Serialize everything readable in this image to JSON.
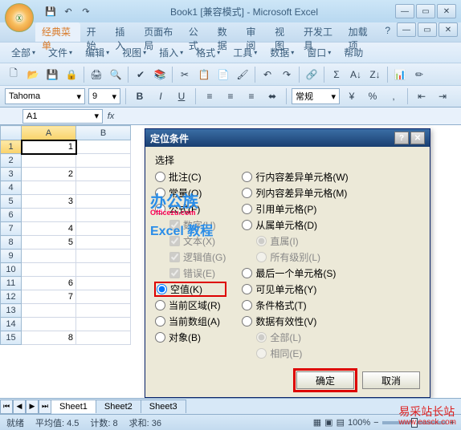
{
  "title": "Book1 [兼容模式] - Microsoft Excel",
  "office_logo": "Ⓧ",
  "qat": {
    "save": "💾",
    "undo": "↶",
    "redo": "↷"
  },
  "tabs": [
    "经典菜单",
    "开始",
    "插入",
    "页面布局",
    "公式",
    "数据",
    "审阅",
    "视图",
    "开发工具",
    "加载项"
  ],
  "menus": {
    "all": "全部",
    "file": "文件",
    "edit": "编辑",
    "view": "视图",
    "insert": "插入",
    "format": "格式",
    "tools": "工具",
    "data": "数据",
    "window": "窗口",
    "help": "帮助"
  },
  "font": {
    "name": "Tahoma",
    "size": "9"
  },
  "style_label": "常规",
  "name_box": "A1",
  "columns": [
    "A",
    "B"
  ],
  "rows": [
    {
      "n": "1",
      "a": "1"
    },
    {
      "n": "2",
      "a": ""
    },
    {
      "n": "3",
      "a": "2"
    },
    {
      "n": "4",
      "a": ""
    },
    {
      "n": "5",
      "a": "3"
    },
    {
      "n": "6",
      "a": ""
    },
    {
      "n": "7",
      "a": "4"
    },
    {
      "n": "8",
      "a": "5"
    },
    {
      "n": "9",
      "a": ""
    },
    {
      "n": "10",
      "a": ""
    },
    {
      "n": "11",
      "a": "6"
    },
    {
      "n": "12",
      "a": "7"
    },
    {
      "n": "13",
      "a": ""
    },
    {
      "n": "14",
      "a": ""
    },
    {
      "n": "15",
      "a": "8"
    }
  ],
  "dialog": {
    "title": "定位条件",
    "select_label": "选择",
    "left": {
      "comments": "批注(C)",
      "constants": "常量(O)",
      "formulas": "公式(F)",
      "sub_num": "数字(U)",
      "sub_text": "文本(X)",
      "sub_logic": "逻辑值(G)",
      "sub_err": "错误(E)",
      "blanks": "空值(K)",
      "current_region": "当前区域(R)",
      "current_array": "当前数组(A)",
      "objects": "对象(B)"
    },
    "right": {
      "row_diff": "行内容差异单元格(W)",
      "col_diff": "列内容差异单元格(M)",
      "precedents": "引用单元格(P)",
      "dependents": "从属单元格(D)",
      "sub_direct": "直属(I)",
      "sub_all_levels": "所有级别(L)",
      "last_cell": "最后一个单元格(S)",
      "visible": "可见单元格(Y)",
      "cond_fmt": "条件格式(T)",
      "validation": "数据有效性(V)",
      "sub_all": "全部(L)",
      "sub_same": "相同(E)"
    },
    "ok": "确定",
    "cancel": "取消"
  },
  "watermark": {
    "l1": "办公族",
    "l2": "Officezu.com",
    "l3": "Excel 教程"
  },
  "sheets": [
    "Sheet1",
    "Sheet2",
    "Sheet3"
  ],
  "status": {
    "ready": "就绪",
    "avg": "平均值: 4.5",
    "count": "计数: 8",
    "sum": "求和: 36",
    "zoom": "100%"
  },
  "watermark_right": {
    "l1": "易采站长站",
    "l2": "www.easck.com"
  }
}
